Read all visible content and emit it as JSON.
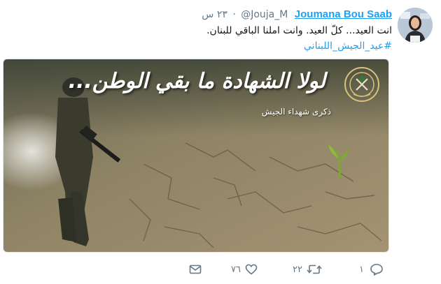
{
  "tweet": {
    "author_name": "Joumana Bou Saab",
    "handle": "@Jouja_M",
    "time": "٢٣ س",
    "text": "انت العيد... كلّ العيد. وانت املنا الباقي  للبنان.",
    "hashtag": "#عيد_الجيش_اللبناني"
  },
  "media": {
    "slogan": "لولا الشهادة ما بقي الوطن...",
    "subtitle": "ذكرى شهداء الجيش"
  },
  "actions": {
    "reply_count": "١",
    "retweet_count": "٢٢",
    "like_count": "٧٦"
  },
  "colors": {
    "link": "#1da1f2",
    "muted": "#657786",
    "text": "#14171a"
  },
  "icons": {
    "reply": "reply-icon",
    "retweet": "retweet-icon",
    "like": "heart-icon",
    "message": "envelope-icon"
  }
}
